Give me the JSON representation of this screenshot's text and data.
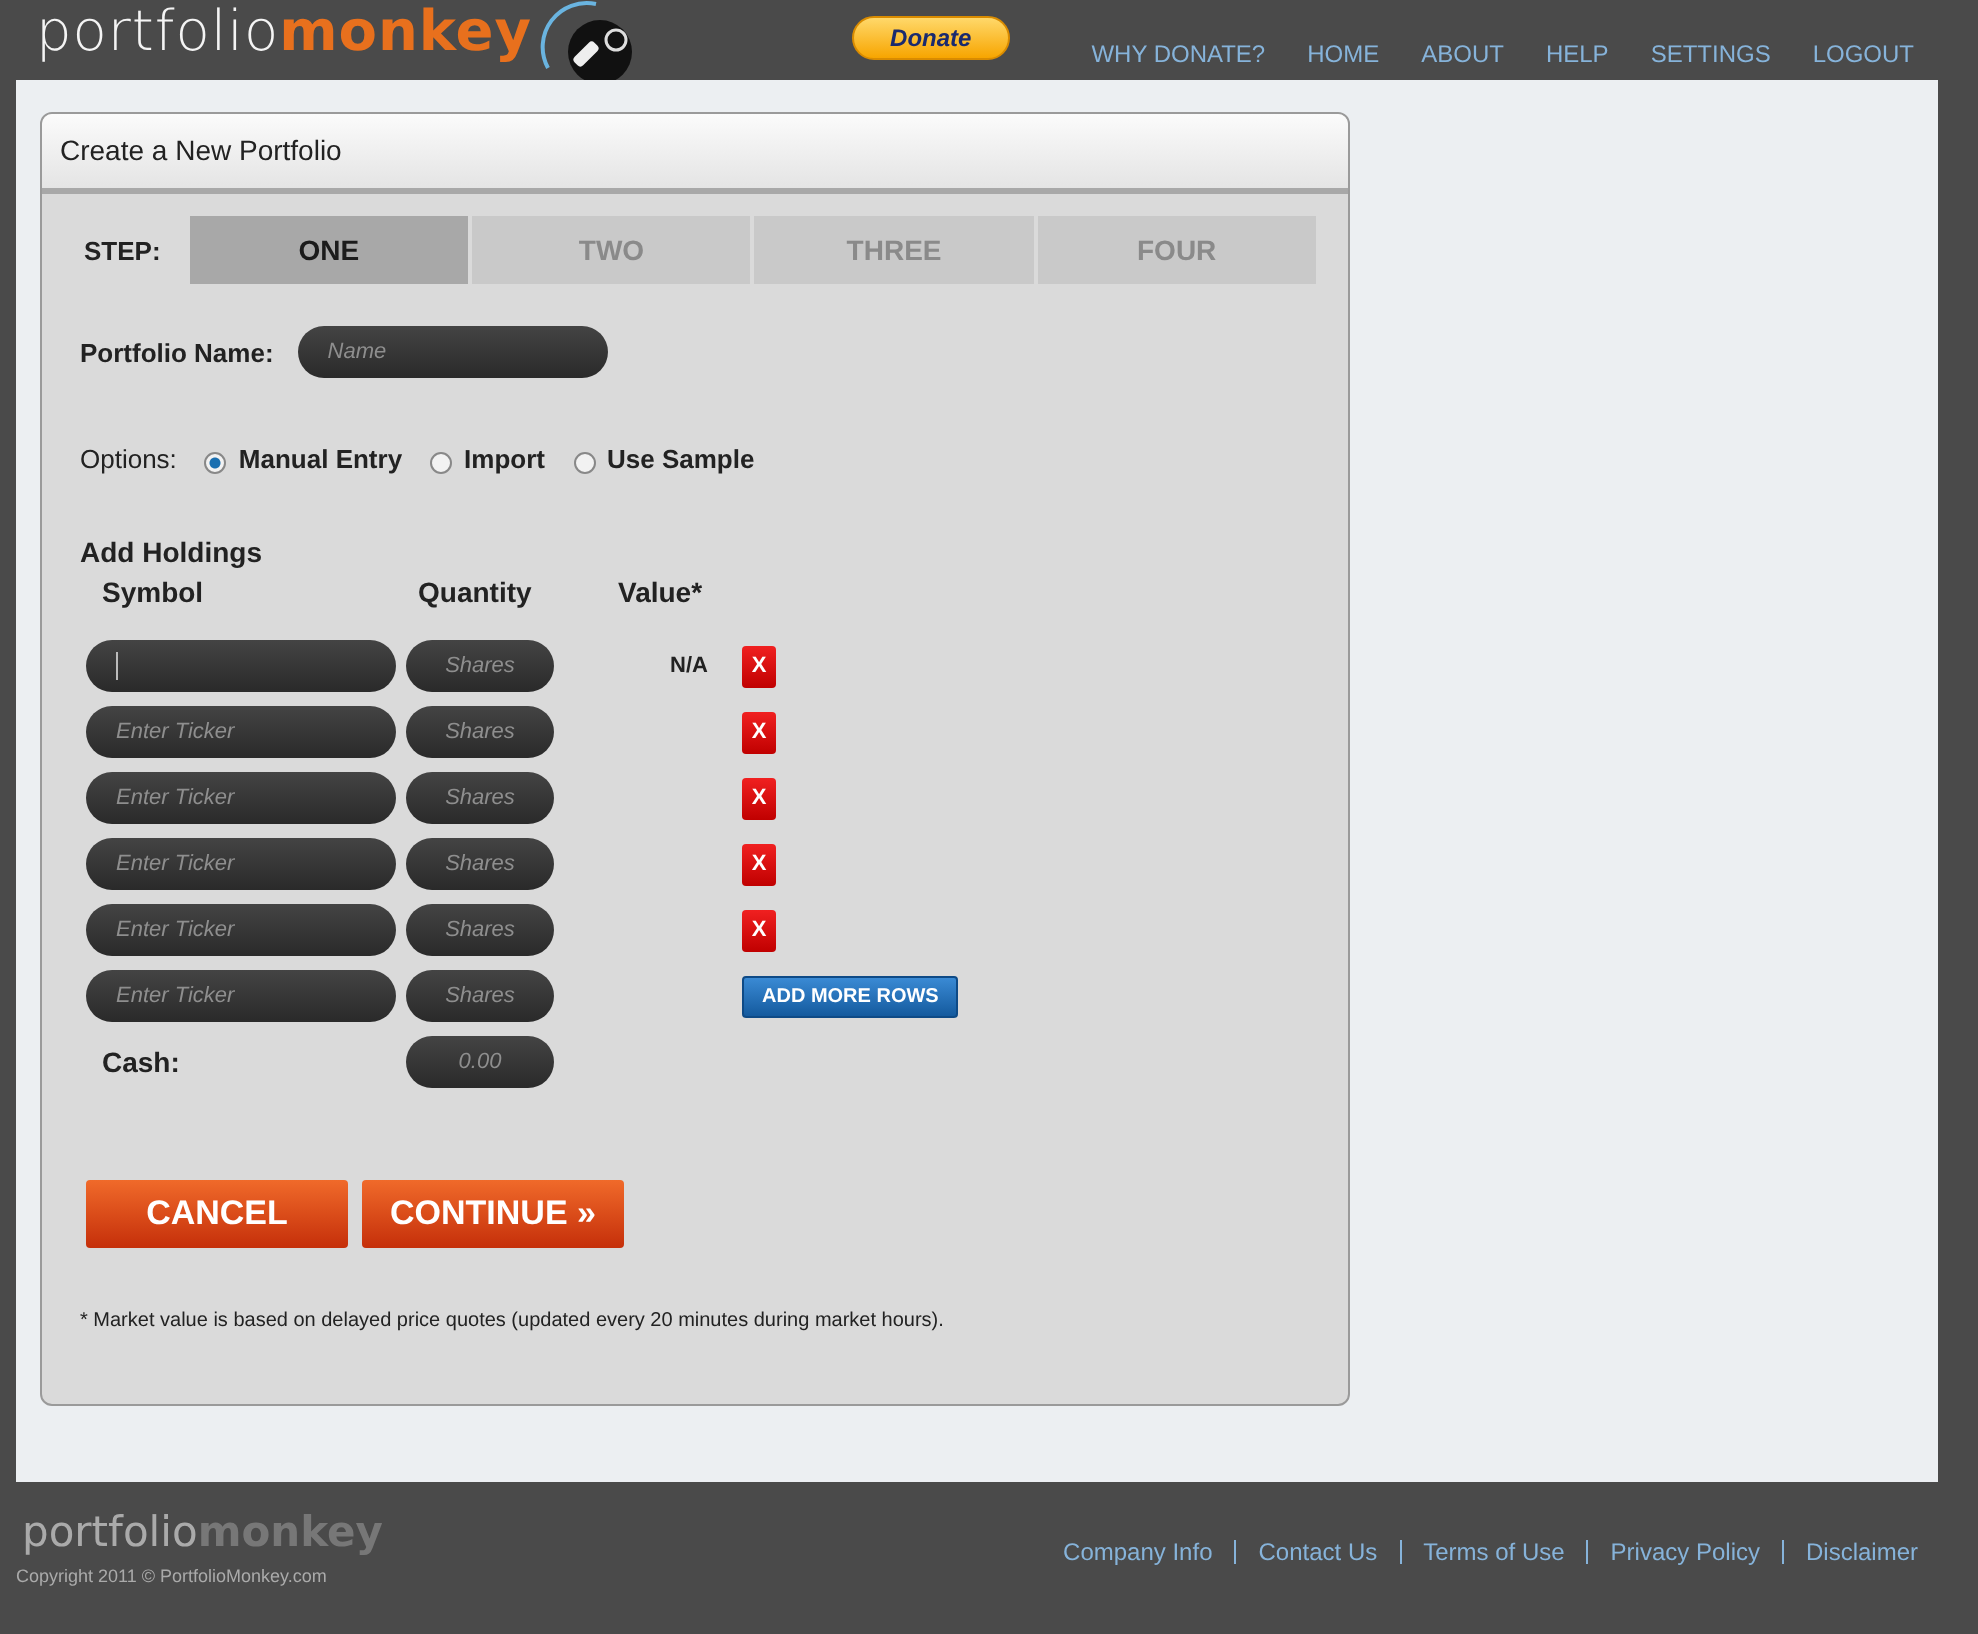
{
  "header": {
    "logo": {
      "first": "portfolio",
      "second": "monkey"
    },
    "donate_button": "Donate",
    "nav": [
      "WHY DONATE?",
      "HOME",
      "ABOUT",
      "HELP",
      "SETTINGS",
      "LOGOUT"
    ]
  },
  "card": {
    "title": "Create a New Portfolio",
    "steps": {
      "label": "STEP:",
      "items": [
        {
          "label": "ONE",
          "selected": true
        },
        {
          "label": "TWO",
          "selected": false
        },
        {
          "label": "THREE",
          "selected": false
        },
        {
          "label": "FOUR",
          "selected": false
        }
      ]
    },
    "portfolio_name": {
      "label": "Portfolio Name:",
      "placeholder": "Name"
    },
    "options": {
      "label": "Options:",
      "items": [
        {
          "label": "Manual Entry",
          "selected": true
        },
        {
          "label": "Import",
          "selected": false
        },
        {
          "label": "Use Sample",
          "selected": false
        }
      ]
    },
    "holdings": {
      "title": "Add Holdings",
      "columns": [
        "Symbol",
        "Quantity",
        "Value*"
      ],
      "rows": [
        {
          "focused": true,
          "quantity_placeholder": "Shares",
          "value": "N/A",
          "action": {
            "kind": "remove",
            "label": "X"
          }
        },
        {
          "symbol_placeholder": "Enter Ticker",
          "quantity_placeholder": "Shares",
          "action": {
            "kind": "remove",
            "label": "X"
          }
        },
        {
          "symbol_placeholder": "Enter Ticker",
          "quantity_placeholder": "Shares",
          "action": {
            "kind": "remove",
            "label": "X"
          }
        },
        {
          "symbol_placeholder": "Enter Ticker",
          "quantity_placeholder": "Shares",
          "action": {
            "kind": "remove",
            "label": "X"
          }
        },
        {
          "symbol_placeholder": "Enter Ticker",
          "quantity_placeholder": "Shares",
          "action": {
            "kind": "remove",
            "label": "X"
          }
        },
        {
          "symbol_placeholder": "Enter Ticker",
          "quantity_placeholder": "Shares",
          "action": {
            "kind": "add",
            "label": "ADD MORE ROWS"
          }
        }
      ],
      "cash": {
        "label": "Cash:",
        "placeholder": "0.00"
      }
    },
    "buttons": {
      "cancel": "CANCEL",
      "continue": "CONTINUE »"
    },
    "footnote": "* Market value is based on delayed price quotes (updated every 20 minutes during market hours)."
  },
  "footer": {
    "logo": {
      "first": "portfolio",
      "second": "monkey"
    },
    "copyright": "Copyright 2011 © PortfolioMonkey.com",
    "links": [
      "Company Info",
      "Contact Us",
      "Terms of Use",
      "Privacy Policy",
      "Disclaimer"
    ]
  }
}
